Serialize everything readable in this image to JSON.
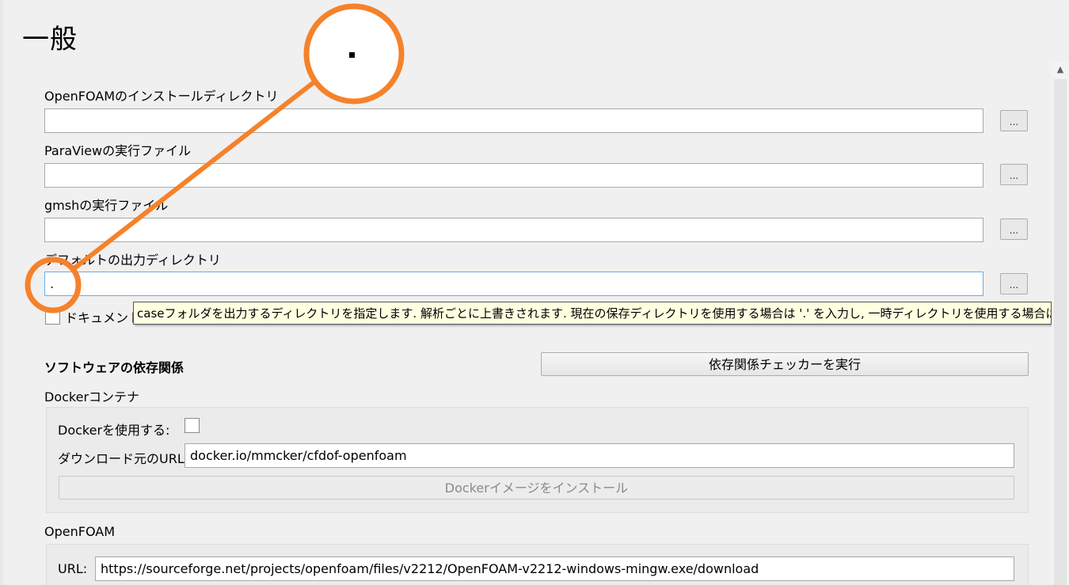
{
  "page": {
    "title": "一般"
  },
  "paths": {
    "openfoam_label": "OpenFOAMのインストールディレクトリ",
    "openfoam_value": "",
    "paraview_label": "ParaViewの実行ファイル",
    "paraview_value": "",
    "gmsh_label": "gmshの実行ファイル",
    "gmsh_value": "",
    "output_label": "デフォルトの出力ディレクトリ",
    "output_value": ".",
    "browse_label": "...",
    "docs_checkbox_label": "ドキュメント"
  },
  "tooltip": {
    "text": "caseフォルダを出力するディレクトリを指定します. 解析ごとに上書きされます. 現在の保存ディレクトリを使用する場合は '.' を入力し, 一時ディレクトリを使用する場合は空白にします."
  },
  "dependencies": {
    "heading": "ソフトウェアの依存関係",
    "checker_button": "依存関係チェッカーを実行"
  },
  "docker": {
    "section_label": "Dockerコンテナ",
    "use_label": "Dockerを使用する:",
    "use_checked": false,
    "url_label": "ダウンロード元のURL:",
    "url_value": "docker.io/mmcker/cfdof-openfoam",
    "install_button": "Dockerイメージをインストール"
  },
  "openfoam": {
    "section_label": "OpenFOAM",
    "url_label": "URL:",
    "url_value": "https://sourceforge.net/projects/openfoam/files/v2212/OpenFOAM-v2212-windows-mingw.exe/download"
  },
  "scrollbar": {
    "up_arrow": "▲"
  },
  "colors": {
    "highlight_circle": "#f5822a",
    "focus_border": "#6fa9e0",
    "tooltip_bg": "#ffffe1"
  }
}
